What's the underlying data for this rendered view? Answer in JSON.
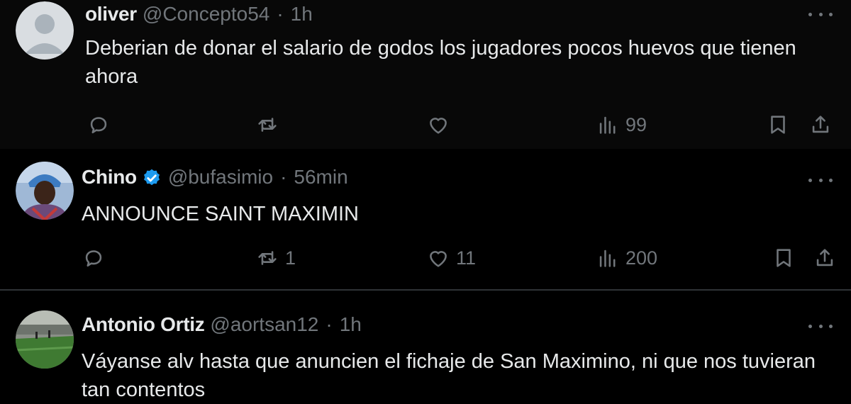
{
  "tweets": [
    {
      "name": "oliver",
      "handle": "@Concepto54",
      "separator": "·",
      "time": "1h",
      "verified": false,
      "text": "Deberian de donar el salario de godos los jugadores pocos huevos que tienen ahora",
      "actions": {
        "reply": "",
        "retweet": "",
        "like": "",
        "views": "99"
      },
      "avatar_icon": "default-avatar-icon"
    },
    {
      "name": "Chino",
      "handle": "@bufasimio",
      "separator": "·",
      "time": "56min",
      "verified": true,
      "text": "ANNOUNCE SAINT MAXIMIN",
      "actions": {
        "reply": "",
        "retweet": "1",
        "like": "11",
        "views": "200"
      },
      "avatar_icon": "person-photo-avatar"
    },
    {
      "name": "Antonio Ortiz",
      "handle": "@aortsan12",
      "separator": "·",
      "time": "1h",
      "verified": false,
      "text": "Váyanse alv hasta que anuncien el fichaje de San Maximino, ni que nos tuvieran tan contentos",
      "avatar_icon": "stadium-photo-avatar"
    }
  ],
  "colors": {
    "background": "#000000",
    "text": "#e7e9ea",
    "muted": "#71767b",
    "verified": "#1d9bf0",
    "divider": "#2f3336"
  }
}
